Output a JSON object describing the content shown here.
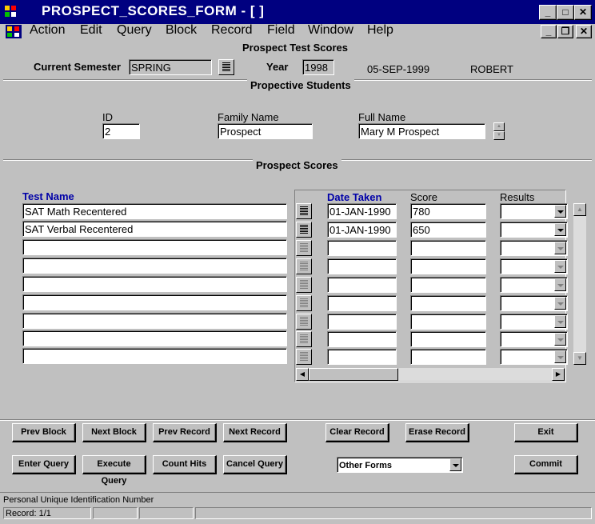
{
  "window": {
    "title": "PROSPECT_SCORES_FORM - [ ]"
  },
  "menu": {
    "items": [
      {
        "label": "Action"
      },
      {
        "label": "Edit"
      },
      {
        "label": "Query"
      },
      {
        "label": "Block"
      },
      {
        "label": "Record"
      },
      {
        "label": "Field"
      },
      {
        "label": "Window"
      },
      {
        "label": "Help"
      }
    ]
  },
  "form": {
    "heading": "Prospect Test Scores"
  },
  "header": {
    "semester_label": "Current Semester",
    "semester_value": "SPRING",
    "year_label": "Year",
    "year_value": "1998",
    "date": "05-SEP-1999",
    "user": "ROBERT"
  },
  "students": {
    "heading": "Propective Students",
    "id_label": "ID",
    "id_value": "2",
    "family_label": "Family Name",
    "family_value": "Prospect",
    "full_label": "Full Name",
    "full_value": "Mary M Prospect"
  },
  "scores": {
    "heading": "Prospect Scores",
    "columns": {
      "test_name": "Test Name",
      "date_taken": "Date Taken",
      "score": "Score",
      "results": "Results"
    },
    "rows": [
      {
        "test_name": "SAT Math Recentered",
        "date_taken": "01-JAN-1990",
        "score": "780",
        "results": ""
      },
      {
        "test_name": "SAT Verbal Recentered",
        "date_taken": "01-JAN-1990",
        "score": "650",
        "results": ""
      },
      {
        "test_name": "",
        "date_taken": "",
        "score": "",
        "results": ""
      },
      {
        "test_name": "",
        "date_taken": "",
        "score": "",
        "results": ""
      },
      {
        "test_name": "",
        "date_taken": "",
        "score": "",
        "results": ""
      },
      {
        "test_name": "",
        "date_taken": "",
        "score": "",
        "results": ""
      },
      {
        "test_name": "",
        "date_taken": "",
        "score": "",
        "results": ""
      },
      {
        "test_name": "",
        "date_taken": "",
        "score": "",
        "results": ""
      },
      {
        "test_name": "",
        "date_taken": "",
        "score": "",
        "results": ""
      }
    ]
  },
  "buttons": {
    "prev_block": "Prev Block",
    "next_block": "Next Block",
    "prev_record": "Prev Record",
    "next_record": "Next Record",
    "clear_record": "Clear Record",
    "erase_record": "Erase Record",
    "exit": "Exit",
    "enter_query": "Enter Query",
    "execute_query": "Execute Query",
    "count_hits": "Count Hits",
    "cancel_query": "Cancel Query",
    "other_forms": "Other Forms",
    "commit": "Commit"
  },
  "status": {
    "hint": "Personal Unique Identification Number",
    "record": "Record: 1/1"
  },
  "colors": {
    "titlebar": "#000080",
    "face": "#c0c0c0",
    "label_accent": "#0000a8"
  }
}
